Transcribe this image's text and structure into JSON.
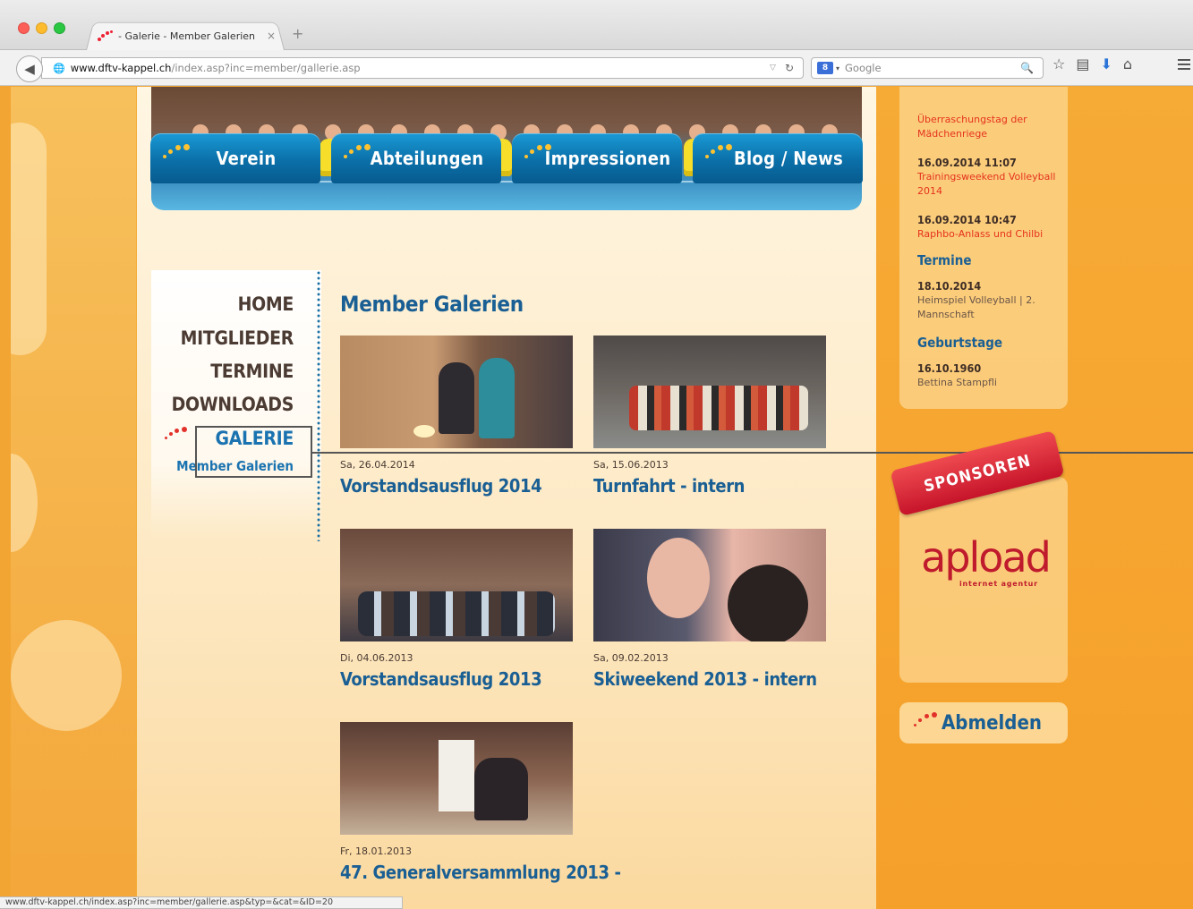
{
  "browser": {
    "tab_title": "- Galerie - Member Galerien",
    "tab_close": "×",
    "new_tab": "+",
    "url_host": "www.dftv-kappel.ch",
    "url_path": "/index.asp?inc=member/gallerie.asp",
    "search_engine_badge": "8",
    "search_placeholder": "Google",
    "status_url": "www.dftv-kappel.ch/index.asp?inc=member/gallerie.asp&typ=&cat=&ID=20"
  },
  "main_nav": [
    {
      "label": "Verein"
    },
    {
      "label": "Abteilungen"
    },
    {
      "label": "Impressionen"
    },
    {
      "label": "Blog / News"
    }
  ],
  "sidebar": {
    "items": [
      {
        "label": "HOME"
      },
      {
        "label": "MITGLIEDER"
      },
      {
        "label": "TERMINE"
      },
      {
        "label": "DOWNLOADS"
      },
      {
        "label": "GALERIE"
      }
    ],
    "sub_item": "Member Galerien"
  },
  "gallery": {
    "title": "Member Galerien",
    "items": [
      {
        "date": "Sa, 26.04.2014",
        "name": "Vorstandsausflug 2014"
      },
      {
        "date": "Sa, 15.06.2013",
        "name": "Turnfahrt - intern"
      },
      {
        "date": "Di, 04.06.2013",
        "name": "Vorstandsausflug 2013"
      },
      {
        "date": "Sa, 09.02.2013",
        "name": "Skiweekend 2013 - intern"
      },
      {
        "date": "Fr, 18.01.2013",
        "name": "47. Generalversammlung 2013 -"
      }
    ]
  },
  "news": {
    "top_text": "Überraschungstag der Mädchenriege",
    "items": [
      {
        "datetime": "16.09.2014 11:07",
        "text": "Trainingsweekend Volleyball 2014"
      },
      {
        "datetime": "16.09.2014 10:47",
        "text": "Raphbo-Anlass und Chilbi"
      }
    ],
    "termine_heading": "Termine",
    "termine": {
      "date": "18.10.2014",
      "text": "Heimspiel Volleyball | 2. Mannschaft"
    },
    "geburtstage_heading": "Geburtstage",
    "geburtstage": {
      "date": "16.10.1960",
      "text": "Bettina Stampfli"
    }
  },
  "sponsors": {
    "ribbon": "SPONSOREN",
    "logo_text": "apload",
    "logo_sub": "internet agentur"
  },
  "logout_label": "Abmelden",
  "colors": {
    "nav_blue": "#0b6fa8",
    "heading_blue": "#1a5f94",
    "accent_red": "#e2312b",
    "page_orange": "#f4ad38"
  }
}
